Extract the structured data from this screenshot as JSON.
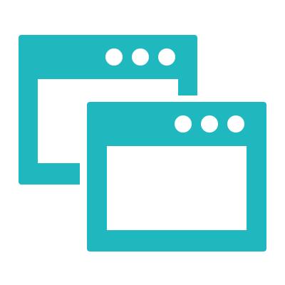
{
  "icon": {
    "name": "multiple-windows-icon",
    "windows": 2,
    "dots_per_window": 3
  },
  "colors": {
    "accent": "#20B8BF",
    "background": "#FFFFFF",
    "content": "#FFFFFF"
  }
}
